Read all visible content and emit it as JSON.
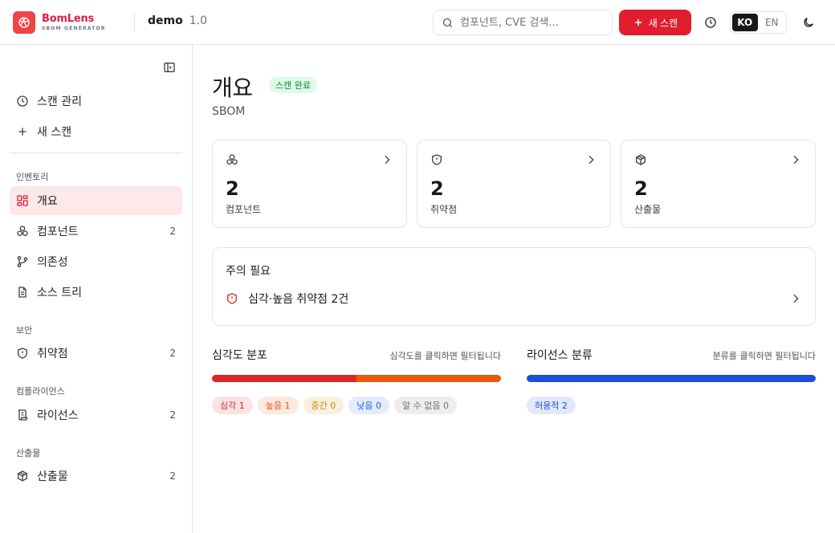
{
  "header": {
    "logo_name": "BomLens",
    "logo_sub": "SBOM GENERATOR",
    "project_name": "demo",
    "project_version": "1.0",
    "search_placeholder": "컴포넌트, CVE 검색...",
    "new_scan_label": "새 스캔",
    "lang_ko": "KO",
    "lang_en": "EN",
    "lang_active": "KO",
    "accent_color": "#e11d2e"
  },
  "sidebar": {
    "top_items": [
      {
        "label": "스캔 관리",
        "icon": "history-icon"
      },
      {
        "label": "새 스캔",
        "icon": "plus-icon"
      }
    ],
    "sections": [
      {
        "title": "인벤토리",
        "items": [
          {
            "label": "개요",
            "icon": "dashboard-icon",
            "count": "",
            "active": true
          },
          {
            "label": "컴포넌트",
            "icon": "components-icon",
            "count": "2"
          },
          {
            "label": "의존성",
            "icon": "git-branch-icon",
            "count": ""
          },
          {
            "label": "소스 트리",
            "icon": "file-text-icon",
            "count": ""
          }
        ]
      },
      {
        "title": "보안",
        "items": [
          {
            "label": "취약점",
            "icon": "shield-alert-icon",
            "count": "2"
          }
        ]
      },
      {
        "title": "컴플라이언스",
        "items": [
          {
            "label": "라이선스",
            "icon": "scroll-icon",
            "count": "2"
          }
        ]
      },
      {
        "title": "산출물",
        "items": [
          {
            "label": "산출물",
            "icon": "package-icon",
            "count": "2"
          }
        ]
      }
    ]
  },
  "main": {
    "title": "개요",
    "status_badge": "스캔 완료",
    "subtitle": "SBOM",
    "stats": [
      {
        "value": "2",
        "label": "컴포넌트",
        "icon": "components-icon"
      },
      {
        "value": "2",
        "label": "취약점",
        "icon": "shield-alert-icon"
      },
      {
        "value": "2",
        "label": "산출물",
        "icon": "package-icon"
      }
    ],
    "attention": {
      "title": "주의 필요",
      "item": "심각·높음 취약점 2건"
    },
    "severity": {
      "title": "심각도 분포",
      "hint": "심각도를 클릭하면 필터됩니다",
      "chips": [
        {
          "label": "심각 1",
          "value": 1,
          "color": "#dc2626"
        },
        {
          "label": "높음 1",
          "value": 1,
          "color": "#ea580c"
        },
        {
          "label": "중간 0",
          "value": 0,
          "color": "#ca8a04"
        },
        {
          "label": "낮음 0",
          "value": 0,
          "color": "#2563eb"
        },
        {
          "label": "알 수 없음 0",
          "value": 0,
          "color": "#71717a"
        }
      ]
    },
    "license": {
      "title": "라이선스 분류",
      "hint": "분류를 클릭하면 필터됩니다",
      "chips": [
        {
          "label": "허용적 2",
          "value": 2,
          "color": "#1d4ed8"
        }
      ]
    }
  }
}
